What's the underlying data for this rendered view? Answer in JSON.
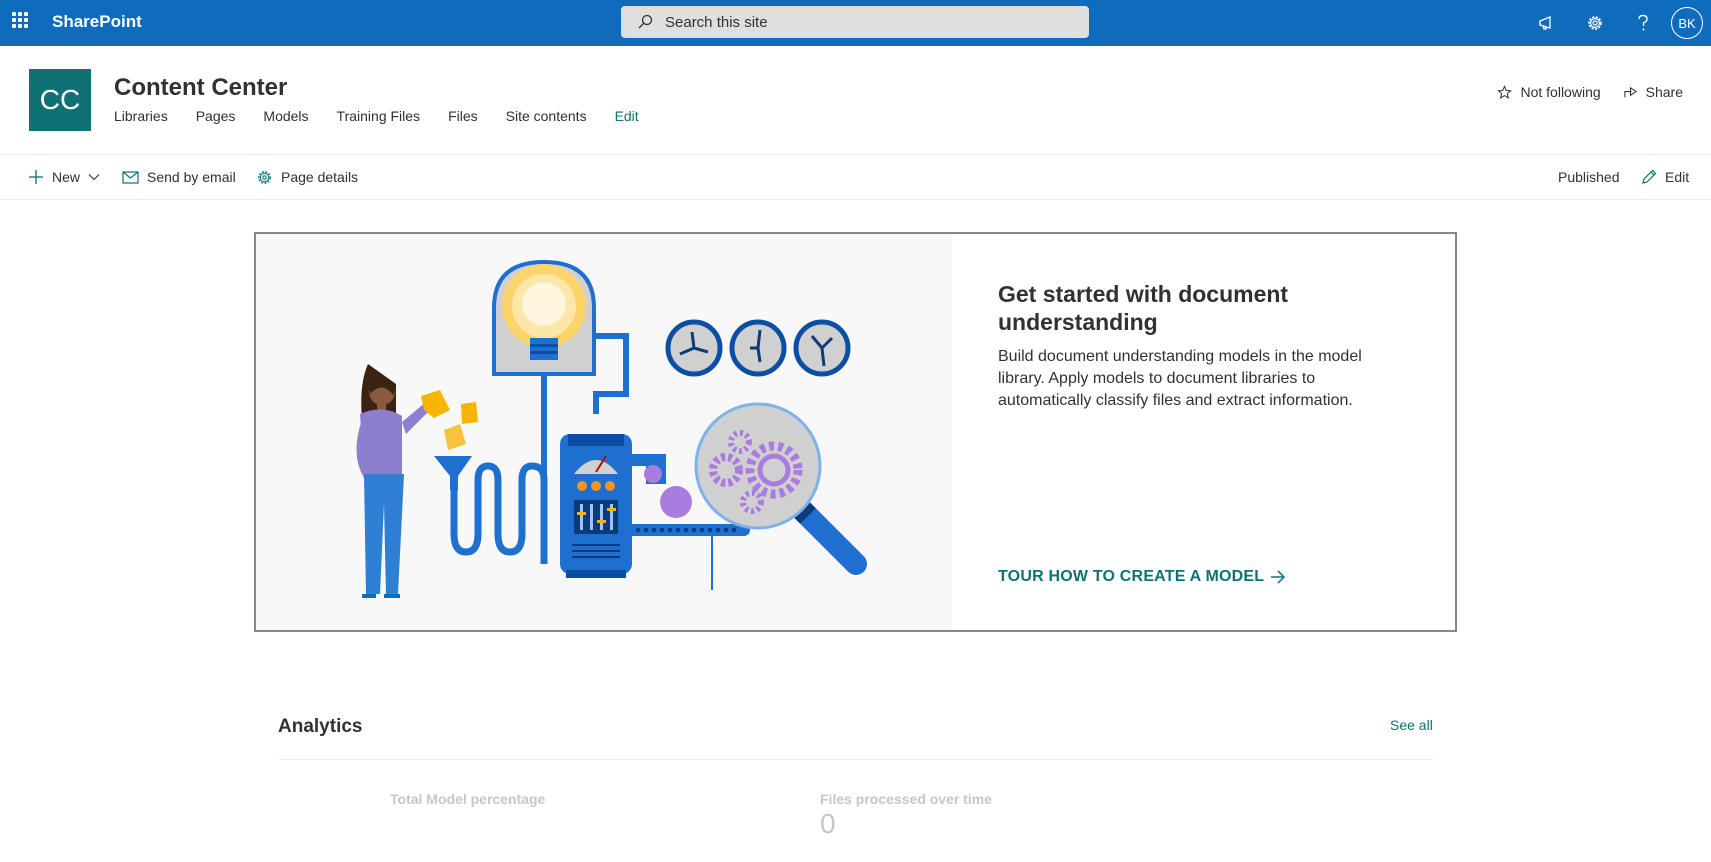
{
  "suitebar": {
    "brand": "SharePoint",
    "search_placeholder": "Search this site",
    "avatar_initials": "BK",
    "icons": [
      "waffle-icon",
      "megaphone-icon",
      "gear-icon",
      "help-icon"
    ]
  },
  "site": {
    "logo_initials": "CC",
    "title": "Content Center",
    "nav": [
      "Libraries",
      "Pages",
      "Models",
      "Training Files",
      "Files",
      "Site contents",
      "Edit"
    ],
    "follow_label": "Not following",
    "share_label": "Share"
  },
  "commandbar": {
    "new_label": "New",
    "email_label": "Send by email",
    "details_label": "Page details",
    "status": "Published",
    "edit_label": "Edit"
  },
  "hero": {
    "title": "Get started with document understanding",
    "description": "Build document understanding models in the model library. Apply models to document libraries to automatically classify files and extract information.",
    "link": "TOUR HOW TO CREATE A MODEL"
  },
  "analytics": {
    "title": "Analytics",
    "see_all": "See all",
    "metric1_label": "Total Model percentage",
    "metric2_label": "Files processed over time",
    "metric2_value": "0"
  },
  "colors": {
    "suitebar": "#0f6cbd",
    "accent": "#0f7173",
    "text": "#323130"
  }
}
